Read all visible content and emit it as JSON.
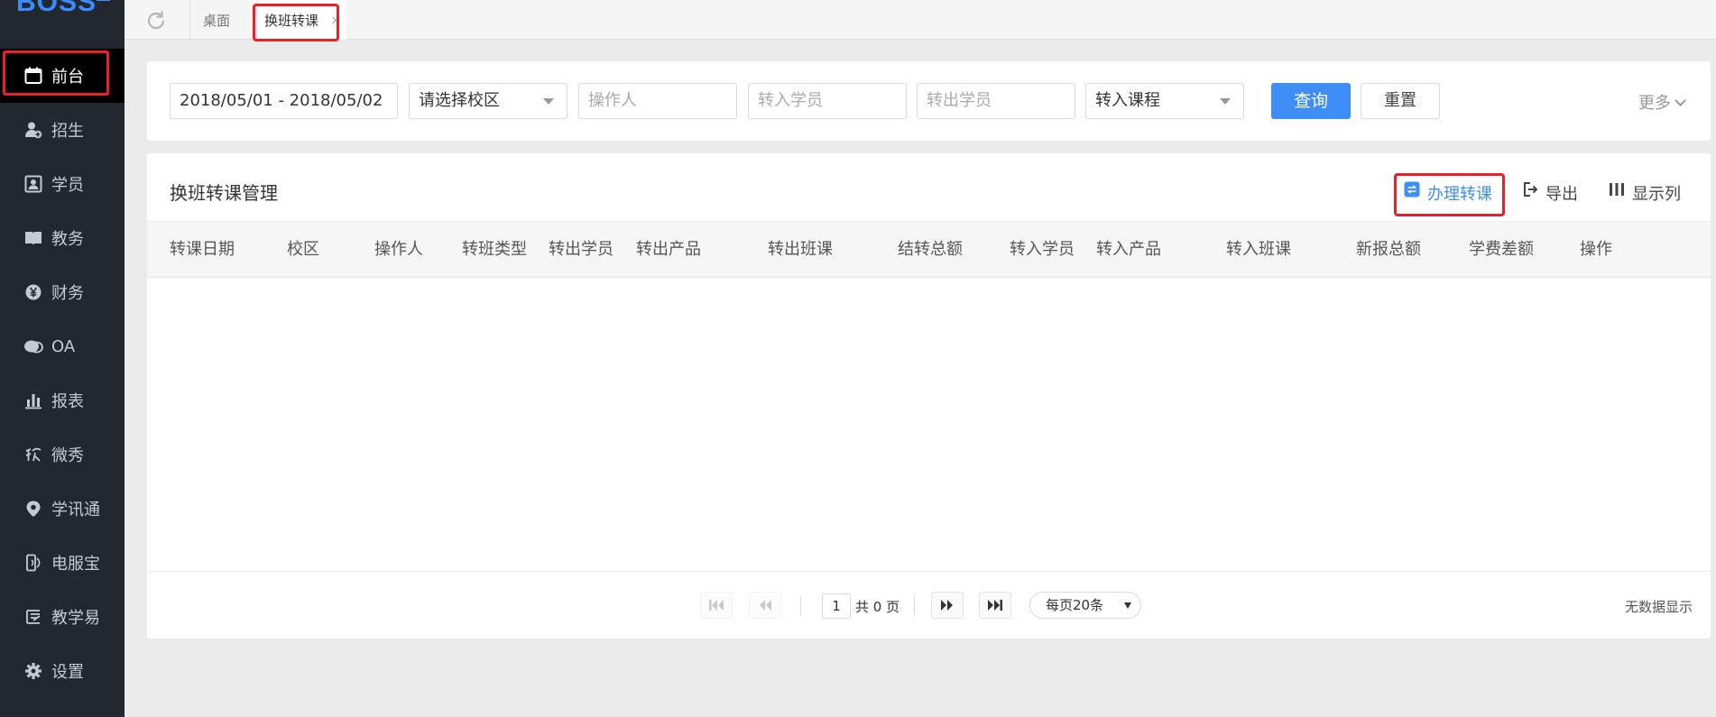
{
  "sidebar": {
    "logo": "BOSS",
    "logo_badge": "系",
    "items": [
      {
        "label": "前台",
        "icon": "calendar-icon"
      },
      {
        "label": "招生",
        "icon": "add-user-icon"
      },
      {
        "label": "学员",
        "icon": "student-card-icon"
      },
      {
        "label": "教务",
        "icon": "book-icon"
      },
      {
        "label": "财务",
        "icon": "yen-coin-icon"
      },
      {
        "label": "OA",
        "icon": "chat-bubbles-icon"
      },
      {
        "label": "报表",
        "icon": "bar-chart-icon"
      },
      {
        "label": "微秀",
        "icon": "xiu-icon"
      },
      {
        "label": "学讯通",
        "icon": "location-pin-icon"
      },
      {
        "label": "电服宝",
        "icon": "phone-signal-icon"
      },
      {
        "label": "教学易",
        "icon": "teaching-icon"
      },
      {
        "label": "设置",
        "icon": "gear-icon"
      }
    ]
  },
  "tabs": {
    "items": [
      {
        "label": "桌面"
      },
      {
        "label": "换班转课",
        "close": "×"
      }
    ]
  },
  "filters": {
    "date_range": "2018/05/01 - 2018/05/02",
    "campus": "请选择校区",
    "operator_placeholder": "操作人",
    "in_student_placeholder": "转入学员",
    "out_student_placeholder": "转出学员",
    "course": "转入课程",
    "query_label": "查询",
    "reset_label": "重置",
    "more_label": "更多"
  },
  "panel": {
    "title": "换班转课管理",
    "actions": {
      "transfer": "办理转课",
      "export": "导出",
      "columns": "显示列"
    }
  },
  "table": {
    "columns": [
      "转课日期",
      "校区",
      "操作人",
      "转班类型",
      "转出学员",
      "转出产品",
      "转出班课",
      "结转总额",
      "转入学员",
      "转入产品",
      "转入班课",
      "新报总额",
      "学费差额",
      "操作"
    ],
    "rows": []
  },
  "pagination": {
    "current_page": "1",
    "total": "共 0 页",
    "page_size": "每页20条",
    "info": "无数据显示"
  },
  "colors": {
    "sidebar_bg": "#23272f",
    "accent": "#3f8ef7",
    "highlight": "#e8202a"
  }
}
